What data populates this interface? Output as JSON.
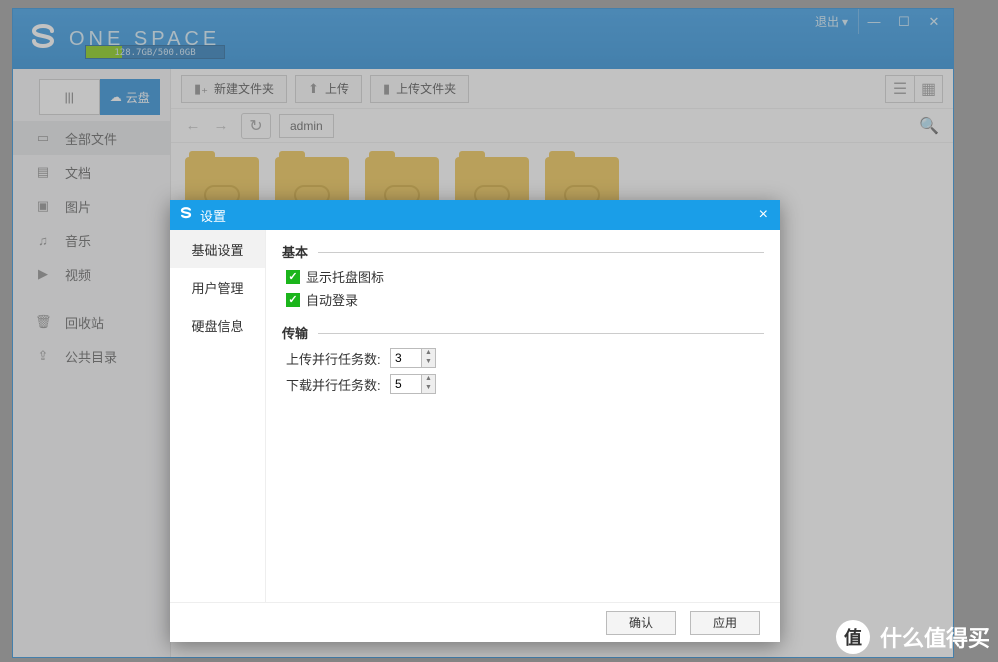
{
  "app": {
    "brand": "ONE SPACE",
    "storage_text": "128.7GB/500.0GB",
    "storage_fill_pct": 26,
    "exit_label": "退出"
  },
  "mode_tabs": {
    "list_icon": "list-icon",
    "cloud_label": "云盘"
  },
  "sidebar": {
    "items": [
      {
        "icon": "folder-icon",
        "label": "全部文件"
      },
      {
        "icon": "document-icon",
        "label": "文档"
      },
      {
        "icon": "picture-icon",
        "label": "图片"
      },
      {
        "icon": "music-icon",
        "label": "音乐"
      },
      {
        "icon": "video-icon",
        "label": "视频"
      }
    ],
    "extra": [
      {
        "icon": "trash-icon",
        "label": "回收站"
      },
      {
        "icon": "public-icon",
        "label": "公共目录"
      }
    ]
  },
  "toolbar": {
    "new_folder": "新建文件夹",
    "upload": "上传",
    "upload_folder": "上传文件夹",
    "path_crumb": "admin"
  },
  "dialog": {
    "title": "设置",
    "nav": [
      "基础设置",
      "用户管理",
      "硬盘信息"
    ],
    "section_basic": "基本",
    "chk_tray": "显示托盘图标",
    "chk_autologin": "自动登录",
    "section_transfer": "传输",
    "upload_concurrent_label": "上传并行任务数:",
    "upload_concurrent_value": "3",
    "download_concurrent_label": "下载并行任务数:",
    "download_concurrent_value": "5",
    "ok": "确认",
    "apply": "应用"
  },
  "watermark": {
    "badge": "值",
    "text": "什么值得买"
  }
}
